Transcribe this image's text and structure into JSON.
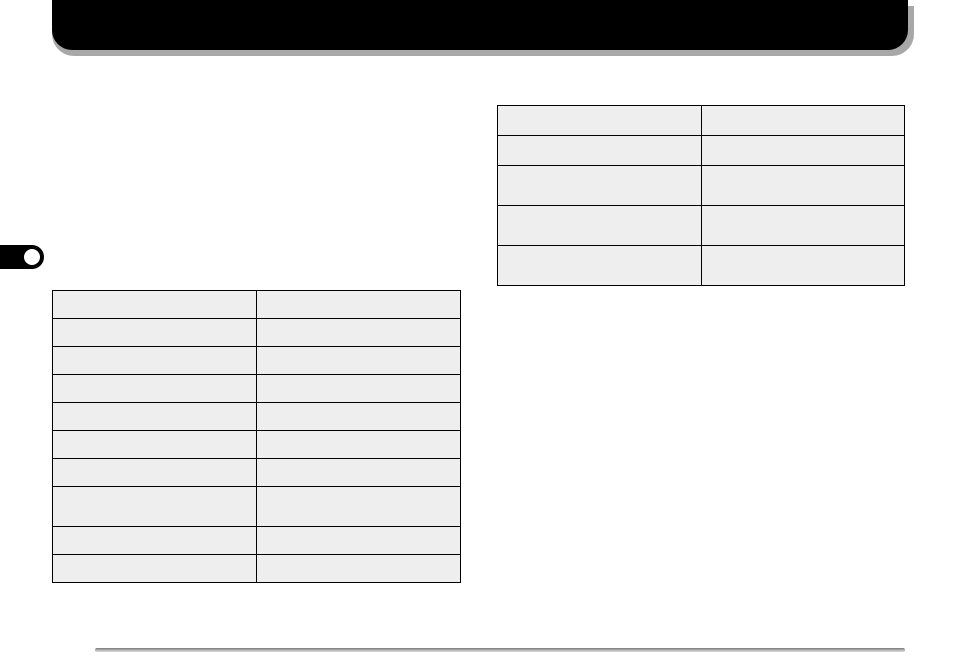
{
  "banner": {
    "title": ""
  },
  "sideTab": {
    "label": ""
  },
  "tableRight": {
    "rows": [
      {
        "c1": "",
        "c2": ""
      },
      {
        "c1": "",
        "c2": ""
      },
      {
        "c1": "",
        "c2": ""
      },
      {
        "c1": "",
        "c2": ""
      },
      {
        "c1": "",
        "c2": ""
      }
    ]
  },
  "tableLeft": {
    "rows": [
      {
        "c1": "",
        "c2": ""
      },
      {
        "c1": "",
        "c2": ""
      },
      {
        "c1": "",
        "c2": ""
      },
      {
        "c1": "",
        "c2": ""
      },
      {
        "c1": "",
        "c2": ""
      },
      {
        "c1": "",
        "c2": ""
      },
      {
        "c1": "",
        "c2": ""
      },
      {
        "c1": "",
        "c2": ""
      },
      {
        "c1": "",
        "c2": ""
      },
      {
        "c1": "",
        "c2": ""
      }
    ]
  }
}
